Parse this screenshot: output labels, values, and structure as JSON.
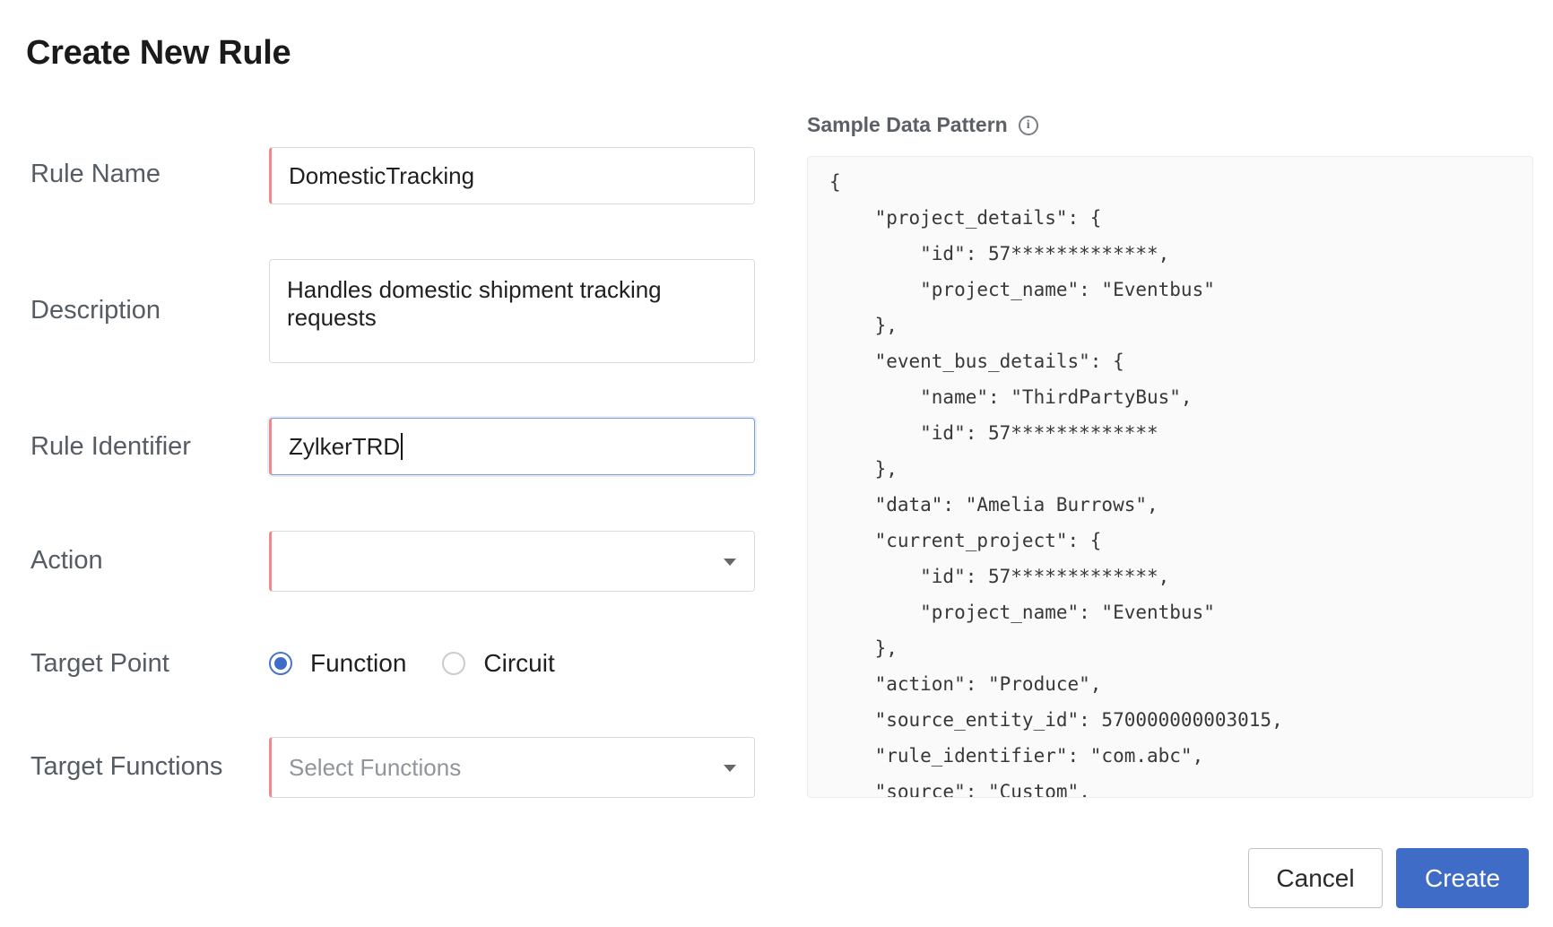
{
  "page": {
    "title": "Create New Rule"
  },
  "form": {
    "rule_name": {
      "label": "Rule Name",
      "value": "DomesticTracking"
    },
    "description": {
      "label": "Description",
      "value": "Handles domestic shipment tracking requests"
    },
    "rule_identifier": {
      "label": "Rule Identifier",
      "value": "ZylkerTRD"
    },
    "action": {
      "label": "Action",
      "value": ""
    },
    "target_point": {
      "label": "Target Point",
      "options": [
        {
          "label": "Function",
          "checked": true
        },
        {
          "label": "Circuit",
          "checked": false
        }
      ]
    },
    "target_functions": {
      "label": "Target Functions",
      "placeholder": "Select Functions"
    }
  },
  "sample": {
    "label": "Sample Data Pattern",
    "info_icon": "info-icon",
    "lines": [
      "{",
      "    \"project_details\": {",
      "        \"id\": 57*************,",
      "        \"project_name\": \"Eventbus\"",
      "    },",
      "    \"event_bus_details\": {",
      "        \"name\": \"ThirdPartyBus\",",
      "        \"id\": 57*************",
      "    },",
      "    \"data\": \"Amelia Burrows\",",
      "    \"current_project\": {",
      "        \"id\": 57*************,",
      "        \"project_name\": \"Eventbus\"",
      "    },",
      "    \"action\": \"Produce\",",
      "    \"source_entity_id\": 570000000003015,",
      "    \"rule_identifier\": \"com.abc\",",
      "    \"source\": \"Custom\","
    ]
  },
  "buttons": {
    "cancel": "Cancel",
    "create": "Create"
  },
  "colors": {
    "accent": "#3f6cc6",
    "required_marker": "#f08a8a"
  }
}
